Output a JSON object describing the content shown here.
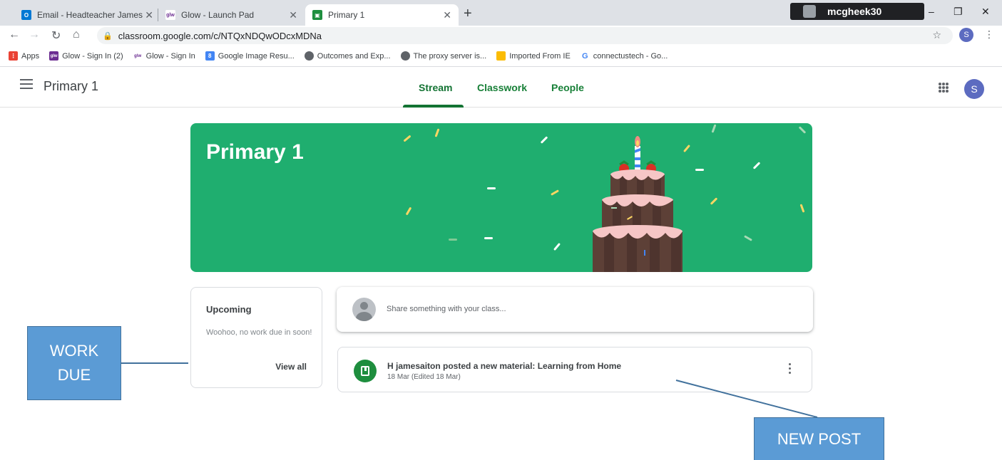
{
  "browser": {
    "tabs": [
      {
        "title": "Email - Headteacher James Aiton",
        "favicon": "outlook-icon",
        "color": "#0078d4"
      },
      {
        "title": "Glow - Launch Pad",
        "favicon": "glow-icon",
        "color": "#6b2c91"
      },
      {
        "title": "Primary 1",
        "favicon": "classroom-icon",
        "color": "#1e8e3e"
      }
    ],
    "new_tab": "+",
    "profile_name": "mcgheek30",
    "url": "classroom.google.com/c/NTQxNDQwODcxMDNa",
    "avatar_letter": "S",
    "bookmarks": [
      {
        "label": "Apps",
        "icon": "apps-grid-icon",
        "color": "#ea4335"
      },
      {
        "label": "Glow - Sign In (2)",
        "icon": "glow-icon",
        "color": "#6b2c91"
      },
      {
        "label": "Glow - Sign In",
        "icon": "glow-icon",
        "color": "#6b2c91"
      },
      {
        "label": "Google Image Resu...",
        "icon": "google-icon",
        "color": "#4285f4"
      },
      {
        "label": "Outcomes and Exp...",
        "icon": "globe-icon",
        "color": "#5f6368"
      },
      {
        "label": "The proxy server is...",
        "icon": "globe-icon",
        "color": "#5f6368"
      },
      {
        "label": "Imported From IE",
        "icon": "folder-icon",
        "color": "#fbbc04"
      },
      {
        "label": "connectustech - Go...",
        "icon": "google-icon",
        "color": "#4285f4"
      }
    ]
  },
  "classroom": {
    "class_name": "Primary 1",
    "tabs": [
      "Stream",
      "Classwork",
      "People"
    ],
    "avatar_letter": "S",
    "banner_title": "Primary 1",
    "banner_color": "#1fae6f",
    "upcoming": {
      "heading": "Upcoming",
      "text": "Woohoo, no work due in soon!",
      "link": "View all"
    },
    "share_placeholder": "Share something with your class...",
    "post": {
      "title": "H jamesaiton posted a new material: Learning from Home",
      "date": "18 Mar (Edited 18 Mar)"
    }
  },
  "annotations": {
    "work_due": "WORK DUE",
    "new_post": "NEW POST"
  }
}
